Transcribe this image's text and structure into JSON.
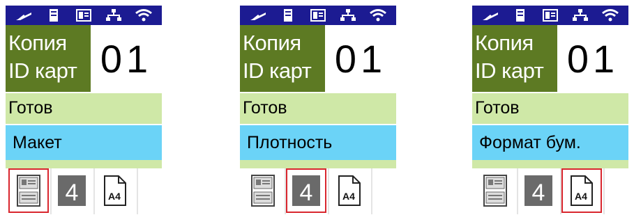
{
  "screen": {
    "title_line1": "Копия",
    "title_line2": "ID карт",
    "copy_count": "01",
    "status": "Готов"
  },
  "panels": [
    {
      "callout": "Макет",
      "selected_option": "layout"
    },
    {
      "callout": "Плотность",
      "selected_option": "density"
    },
    {
      "callout": "Формат бум.",
      "selected_option": "paper-size"
    }
  ],
  "options": {
    "density_value": "4",
    "paper_size_value": "A4"
  },
  "status_icons": [
    "toner-icon",
    "memory-card-icon",
    "phonebook-icon",
    "network-icon",
    "wifi-icon"
  ],
  "colors": {
    "status_bar": "#1c1b92",
    "title_bg": "#5d7a23",
    "status_bg": "#cfe8a7",
    "callout_bg": "#6bd3f7",
    "selection_border": "#d9262e"
  }
}
